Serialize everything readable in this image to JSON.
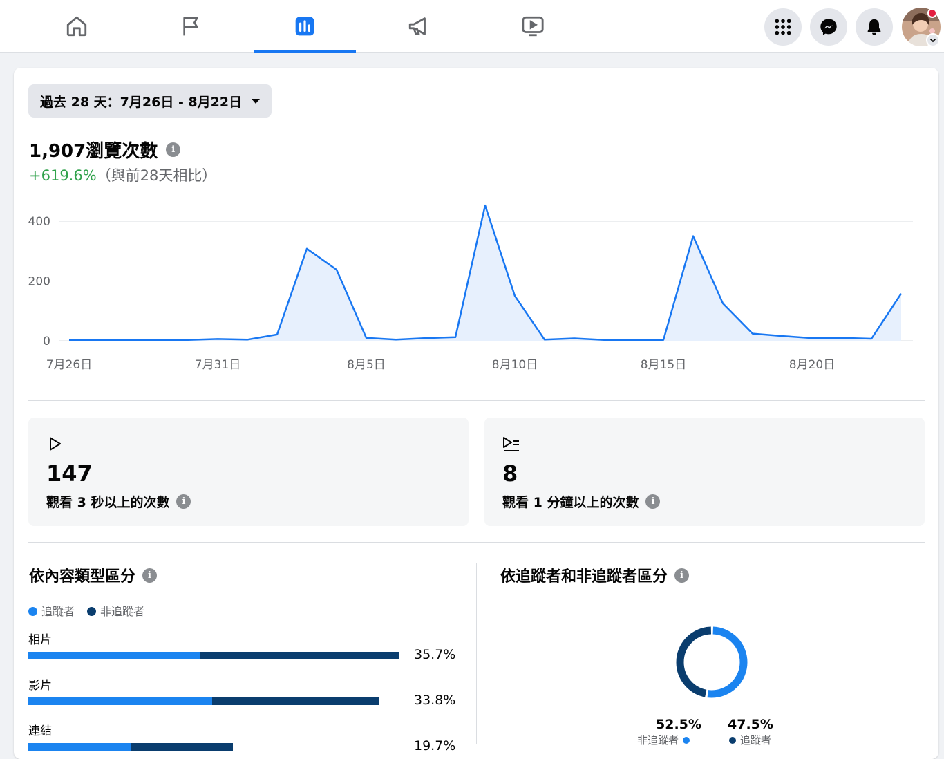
{
  "nav": {
    "tabs": [
      {
        "name": "home",
        "icon": "home-icon"
      },
      {
        "name": "pages",
        "icon": "flag-icon"
      },
      {
        "name": "insights",
        "icon": "bar-chart-icon",
        "active": true
      },
      {
        "name": "ads",
        "icon": "megaphone-icon"
      },
      {
        "name": "video",
        "icon": "video-icon"
      }
    ],
    "right": [
      "menu-grid-icon",
      "messenger-icon",
      "bell-icon",
      "avatar"
    ]
  },
  "date_range": {
    "label": "過去 28 天：7月26日 - 8月22日"
  },
  "views": {
    "value": "1,907瀏覽次數",
    "delta": "+619.6%",
    "delta_note": "（與前28天相比）"
  },
  "chart_data": {
    "type": "area",
    "x_tick_labels": [
      "7月26日",
      "7月31日",
      "8月5日",
      "8月10日",
      "8月15日",
      "8月20日"
    ],
    "y_tick_labels": [
      "0",
      "200",
      "400"
    ],
    "ylim": [
      0,
      400
    ],
    "values": [
      3,
      3,
      3,
      3,
      3,
      6,
      4,
      21,
      308,
      238,
      10,
      4,
      9,
      12,
      453,
      150,
      4,
      8,
      3,
      2,
      3,
      350,
      125,
      24,
      16,
      9,
      10,
      7,
      158
    ],
    "colors": {
      "line": "#1877f2",
      "fill": "#e7f0fd",
      "grid": "#dadde1"
    }
  },
  "stats": [
    {
      "icon": "play-icon",
      "value": "147",
      "label": "觀看 3 秒以上的次數"
    },
    {
      "icon": "play-list-icon",
      "value": "8",
      "label": "觀看 1 分鐘以上的次數"
    }
  ],
  "content_type": {
    "title": "依內容類型區分",
    "legend": [
      {
        "label": "追蹤者",
        "color": "#1b84f0"
      },
      {
        "label": "非追蹤者",
        "color": "#0a3d6e"
      }
    ],
    "rows": [
      {
        "label": "相片",
        "pct": "35.7%",
        "follower": 0.465,
        "non_follower": 0.535,
        "total": 35.7
      },
      {
        "label": "影片",
        "pct": "33.8%",
        "follower": 0.525,
        "non_follower": 0.475,
        "total": 33.8
      },
      {
        "label": "連結",
        "pct": "19.7%",
        "follower": 0.5,
        "non_follower": 0.5,
        "total": 19.7
      }
    ]
  },
  "followers": {
    "title": "依追蹤者和非追蹤者區分",
    "items": [
      {
        "pct": "52.5%",
        "label": "非追蹤者",
        "color": "#1b84f0",
        "value": 52.5
      },
      {
        "pct": "47.5%",
        "label": "追蹤者",
        "color": "#0a3d6e",
        "value": 47.5
      }
    ]
  }
}
